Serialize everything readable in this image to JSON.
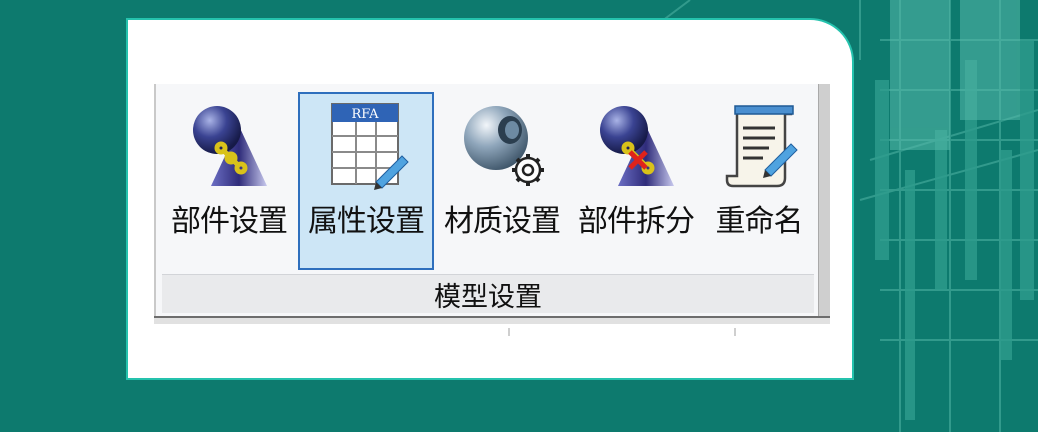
{
  "ribbon": {
    "buttons": [
      {
        "label": "部件设置",
        "icon": "component-settings-icon",
        "active": false
      },
      {
        "label": "属性设置",
        "icon": "property-table-icon",
        "badge": "RFA",
        "active": true
      },
      {
        "label": "材质设置",
        "icon": "material-sphere-gear-icon",
        "active": false
      },
      {
        "label": "部件拆分",
        "icon": "component-split-icon",
        "active": false
      },
      {
        "label": "重命名",
        "icon": "rename-document-icon",
        "active": false
      }
    ],
    "group_label": "模型设置"
  },
  "colors": {
    "background": "#0d7a6e",
    "card_border": "#25c2ad",
    "active_fill": "#cde6f6",
    "active_border": "#2e6fbd"
  }
}
